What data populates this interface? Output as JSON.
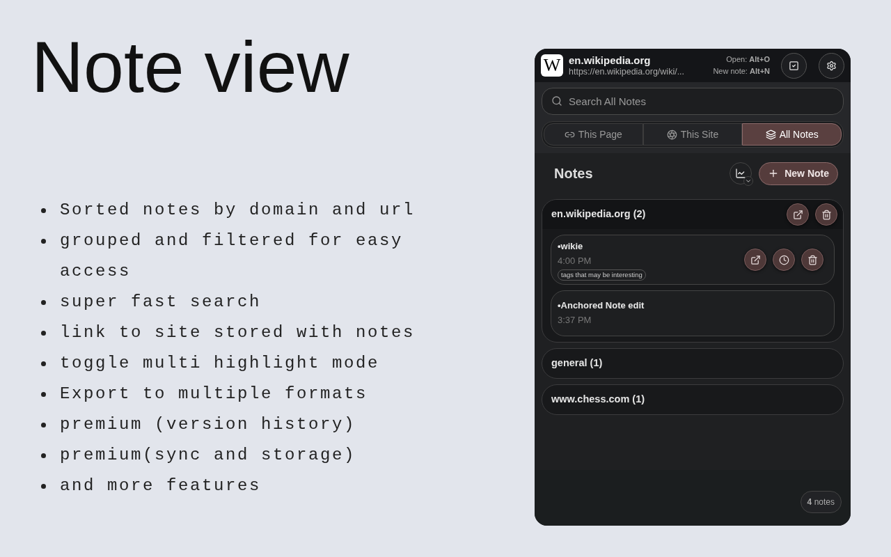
{
  "title": "Note view",
  "features": [
    "Sorted notes by domain and url",
    "grouped and filtered for easy access",
    "super fast search",
    "link to site stored with notes",
    "toggle multi highlight mode",
    "Export to multiple formats",
    "premium (version history)",
    "premium(sync and storage)",
    "and more features"
  ],
  "popup": {
    "header": {
      "logo": "W",
      "site": "en.wikipedia.org",
      "url": "https://en.wikipedia.org/wiki/...",
      "shortcuts": [
        "Open: **Alt+O**",
        "New note: **Alt+N**"
      ]
    },
    "search": {
      "placeholder": "Search All Notes"
    },
    "tabs": [
      {
        "label": "This Page",
        "selected": false
      },
      {
        "label": "This Site",
        "selected": false
      },
      {
        "label": "All Notes",
        "selected": true
      }
    ],
    "notes_title": "Notes",
    "new_note_button": "New Note",
    "groups": [
      {
        "title": "en.wikipedia.org (2)",
        "expanded": true,
        "notes": [
          {
            "title": "•wikie",
            "time": "4:00 PM",
            "tag": "tags that may be interesting",
            "actions_shown": true
          },
          {
            "title": "•Anchored Note edit",
            "time": "3:37 PM",
            "actions_shown": false
          }
        ]
      },
      {
        "title": "general (1)",
        "expanded": false
      },
      {
        "title": "www.chess.com (1)",
        "expanded": false
      }
    ],
    "count": "**4** notes"
  }
}
